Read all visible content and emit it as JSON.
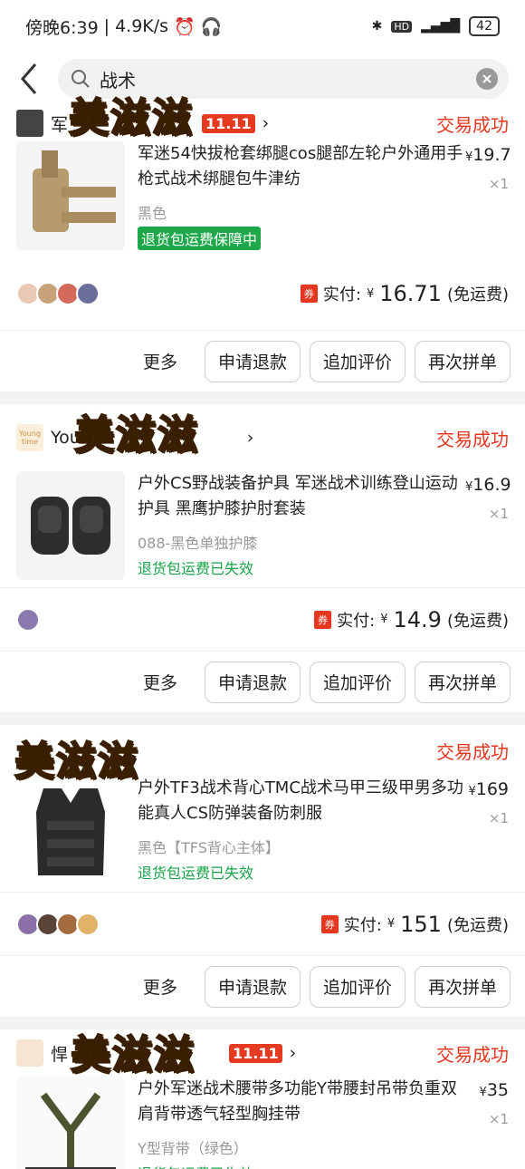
{
  "status_bar": {
    "time": "傍晚6:39",
    "net_speed": "4.9K/s",
    "battery": "42"
  },
  "search": {
    "query": "战术"
  },
  "watermark": "美滋滋",
  "orders": [
    {
      "shop": "军",
      "status": "交易成功",
      "title": "军迷54快拔枪套绑腿cos腿部左轮户外通用手枪式战术绑腿包牛津纺",
      "spec": "黑色",
      "tag": "退货包运费保障中",
      "price": "19.7",
      "qty": "×1",
      "paid_label": "实付:",
      "paid": "16.71",
      "shipping": "(免运费)"
    },
    {
      "shop": "You",
      "shop_logo": "Young time",
      "status": "交易成功",
      "title": "户外CS野战装备护具 军迷战术训练登山运动护具 黑鹰护膝护肘套装",
      "spec": "088-黑色单独护膝",
      "tag": "退货包运费已失效",
      "price": "16.9",
      "qty": "×1",
      "paid_label": "实付:",
      "paid": "14.9",
      "shipping": "(免运费)"
    },
    {
      "shop": "",
      "status": "交易成功",
      "title": "户外TF3战术背心TMC战术马甲三级甲男多功能真人CS防弹装备防刺服",
      "spec": "黑色【TFS背心主体】",
      "tag": "退货包运费已失效",
      "price": "169",
      "qty": "×1",
      "paid_label": "实付:",
      "paid": "151",
      "shipping": "(免运费)"
    },
    {
      "shop": "悍",
      "status": "交易成功",
      "title": "户外军迷战术腰带多功能Y带腰封吊带负重双肩背带透气轻型胸挂带",
      "spec": "Y型背带（绿色）",
      "tag": "退货包运费已失效",
      "price": "35",
      "qty": "×1"
    }
  ],
  "actions": {
    "more": "更多",
    "refund": "申请退款",
    "review": "追加评价",
    "reorder": "再次拼单"
  },
  "badge_1111": "11.11",
  "currency": "¥",
  "coupon": "券"
}
